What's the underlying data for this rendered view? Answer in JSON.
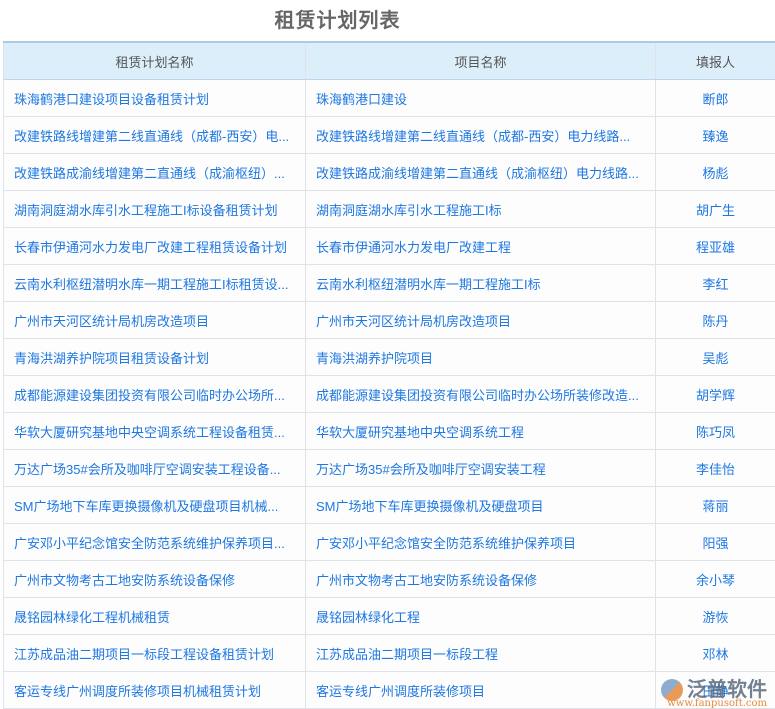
{
  "title": "租赁计划列表",
  "columns": [
    "租赁计划名称",
    "项目名称",
    "填报人"
  ],
  "rows": [
    {
      "plan": "珠海鹤港口建设项目设备租赁计划",
      "project": "珠海鹤港口建设",
      "reporter": "断郎"
    },
    {
      "plan": "改建铁路线增建第二线直通线（成都-西安）电...",
      "project": "改建铁路线增建第二线直通线（成都-西安）电力线路...",
      "reporter": "臻逸"
    },
    {
      "plan": "改建铁路成渝线增建第二直通线（成渝枢纽）...",
      "project": "改建铁路成渝线增建第二直通线（成渝枢纽）电力线路...",
      "reporter": "杨彪"
    },
    {
      "plan": "湖南洞庭湖水库引水工程施工I标设备租赁计划",
      "project": "湖南洞庭湖水库引水工程施工I标",
      "reporter": "胡广生"
    },
    {
      "plan": "长春市伊通河水力发电厂改建工程租赁设备计划",
      "project": "长春市伊通河水力发电厂改建工程",
      "reporter": "程亚雄"
    },
    {
      "plan": "云南水利枢纽潜明水库一期工程施工I标租赁设...",
      "project": "云南水利枢纽潜明水库一期工程施工I标",
      "reporter": "李红"
    },
    {
      "plan": "广州市天河区统计局机房改造项目",
      "project": "广州市天河区统计局机房改造项目",
      "reporter": "陈丹"
    },
    {
      "plan": "青海洪湖养护院项目租赁设备计划",
      "project": "青海洪湖养护院项目",
      "reporter": "吴彪"
    },
    {
      "plan": "成都能源建设集团投资有限公司临时办公场所...",
      "project": "成都能源建设集团投资有限公司临时办公场所装修改造...",
      "reporter": "胡学辉"
    },
    {
      "plan": "华软大厦研究基地中央空调系统工程设备租赁...",
      "project": "华软大厦研究基地中央空调系统工程",
      "reporter": "陈巧凤"
    },
    {
      "plan": "万达广场35#会所及咖啡厅空调安装工程设备...",
      "project": "万达广场35#会所及咖啡厅空调安装工程",
      "reporter": "李佳怡"
    },
    {
      "plan": "SM广场地下车库更换摄像机及硬盘项目机械...",
      "project": "SM广场地下车库更换摄像机及硬盘项目",
      "reporter": "蒋丽"
    },
    {
      "plan": "广安邓小平纪念馆安全防范系统维护保养项目...",
      "project": "广安邓小平纪念馆安全防范系统维护保养项目",
      "reporter": "阳强"
    },
    {
      "plan": "广州市文物考古工地安防系统设备保修",
      "project": "广州市文物考古工地安防系统设备保修",
      "reporter": "余小琴"
    },
    {
      "plan": "晟铭园林绿化工程机械租赁",
      "project": "晟铭园林绿化工程",
      "reporter": "游恢"
    },
    {
      "plan": "江苏成品油二期项目一标段工程设备租赁计划",
      "project": "江苏成品油二期项目一标段工程",
      "reporter": "邓林"
    },
    {
      "plan": "客运专线广州调度所装修项目机械租赁计划",
      "project": "客运专线广州调度所装修项目",
      "reporter": "田静"
    }
  ],
  "watermark": {
    "name": "泛普软件",
    "url": "www.fanpusoft.com"
  }
}
